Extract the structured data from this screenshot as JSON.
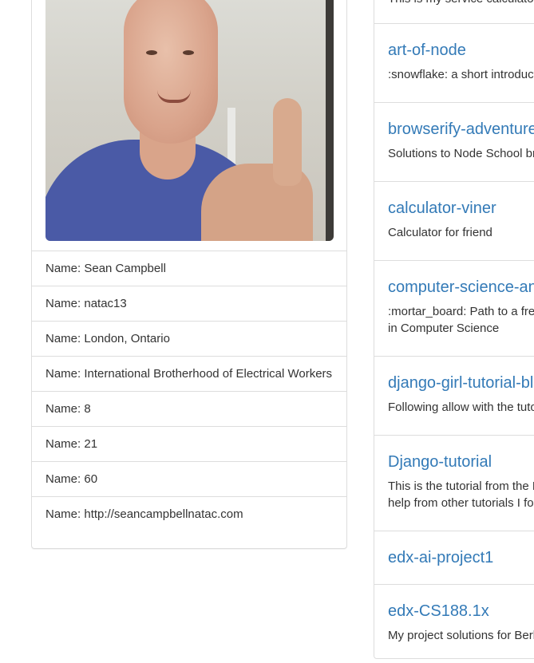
{
  "profile": {
    "photo_alt": "",
    "fields": [
      "Name: Sean Campbell",
      "Name: natac13",
      "Name: London, Ontario",
      "Name: International Brotherhood of Electrical Workers",
      "Name: 8",
      "Name: 21",
      "Name: 60",
      "Name: http://seancampbellnatac.com"
    ]
  },
  "repos": {
    "top_partial_desc": "This is my service calculator",
    "items": [
      {
        "title": "art-of-node",
        "desc": [
          ":snowflake: a short introduction to node.js"
        ]
      },
      {
        "title": "browserify-adventure",
        "desc": [
          "Solutions to Node School browserify"
        ]
      },
      {
        "title": "calculator-viner",
        "desc": [
          "Calculator for friend"
        ]
      },
      {
        "title": "computer-science-and-more",
        "desc": [
          ":mortar_board: Path to a free self-taught education",
          "in Computer Science"
        ]
      },
      {
        "title": "django-girl-tutorial-blog",
        "desc": [
          "Following allow with the tutorial"
        ]
      },
      {
        "title": "Django-tutorial",
        "desc": [
          "This is the tutorial from the Django docs with",
          "help from other tutorials I found"
        ]
      },
      {
        "title": "edx-ai-project1",
        "desc": []
      },
      {
        "title": "edx-CS188.1x",
        "desc": [
          "My project solutions for Berkeley"
        ]
      }
    ]
  }
}
